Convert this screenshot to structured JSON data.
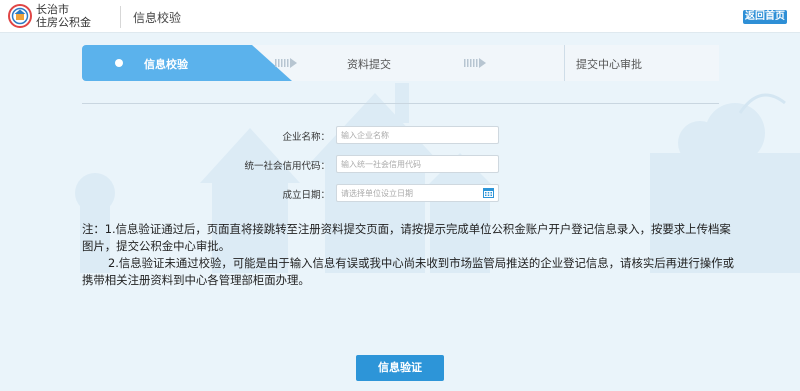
{
  "header": {
    "brand_line1": "长治市",
    "brand_line2": "住房公积金",
    "page_title": "信息校验",
    "home_button": "返回首页"
  },
  "steps": [
    {
      "label": "信息校验",
      "active": true
    },
    {
      "label": "资料提交",
      "active": false
    },
    {
      "label": "提交中心审批",
      "active": false
    }
  ],
  "form": {
    "company_name": {
      "label": "企业名称：",
      "placeholder": "输入企业名称",
      "value": ""
    },
    "credit_code": {
      "label": "统一社会信用代码：",
      "placeholder": "输入统一社会信用代码",
      "value": ""
    },
    "founded_date": {
      "label": "成立日期：",
      "placeholder": "请选择单位设立日期",
      "value": ""
    }
  },
  "notes": {
    "note1": "注：1.信息验证通过后，页面直将接跳转至注册资料提交页面，请按提示完成单位公积金账户开户登记信息录入，按要求上传档案图片，提交公积金中心审批。",
    "note2": "2.信息验证未通过校验，可能是由于输入信息有误或我中心尚未收到市场监管局推送的企业登记信息，请核实后再进行操作或携带相关注册资料到中心各管理部柜面办理。"
  },
  "submit_button": "信息验证",
  "colors": {
    "accent": "#2d95d8",
    "step_active": "#5bb2ec",
    "background": "#eaf4fa"
  }
}
